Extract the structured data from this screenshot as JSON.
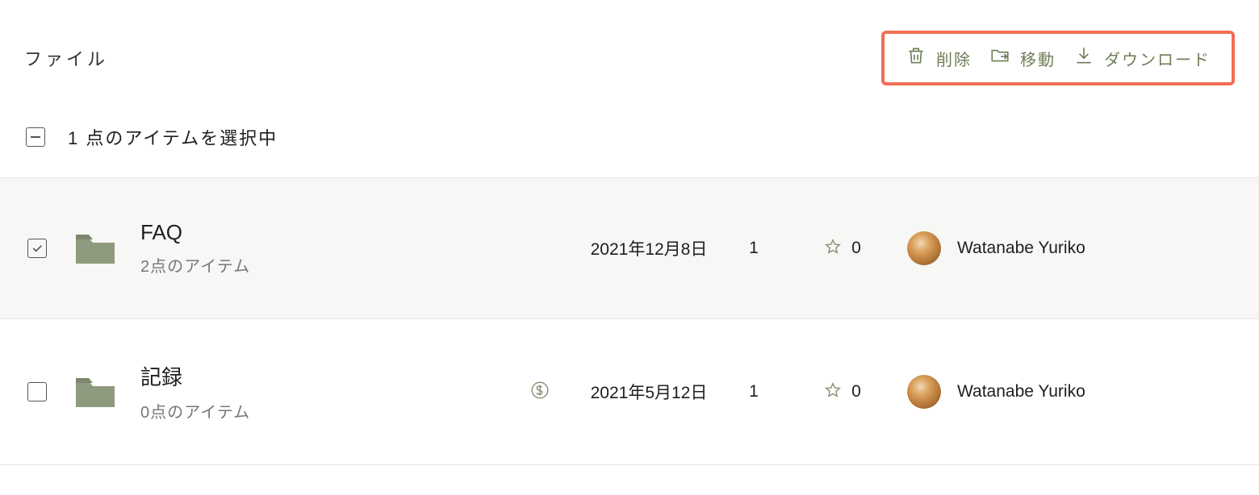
{
  "header": {
    "title": "ファイル"
  },
  "actions": {
    "delete": "削除",
    "move": "移動",
    "download": "ダウンロード"
  },
  "selection": {
    "text": "1 点のアイテムを選択中"
  },
  "rows": [
    {
      "checked": true,
      "name": "FAQ",
      "sub": "2点のアイテム",
      "has_price": false,
      "date": "2021年12月8日",
      "count": "1",
      "stars": "0",
      "owner": "Watanabe Yuriko"
    },
    {
      "checked": false,
      "name": "記録",
      "sub": "0点のアイテム",
      "has_price": true,
      "date": "2021年5月12日",
      "count": "1",
      "stars": "0",
      "owner": "Watanabe Yuriko"
    }
  ]
}
